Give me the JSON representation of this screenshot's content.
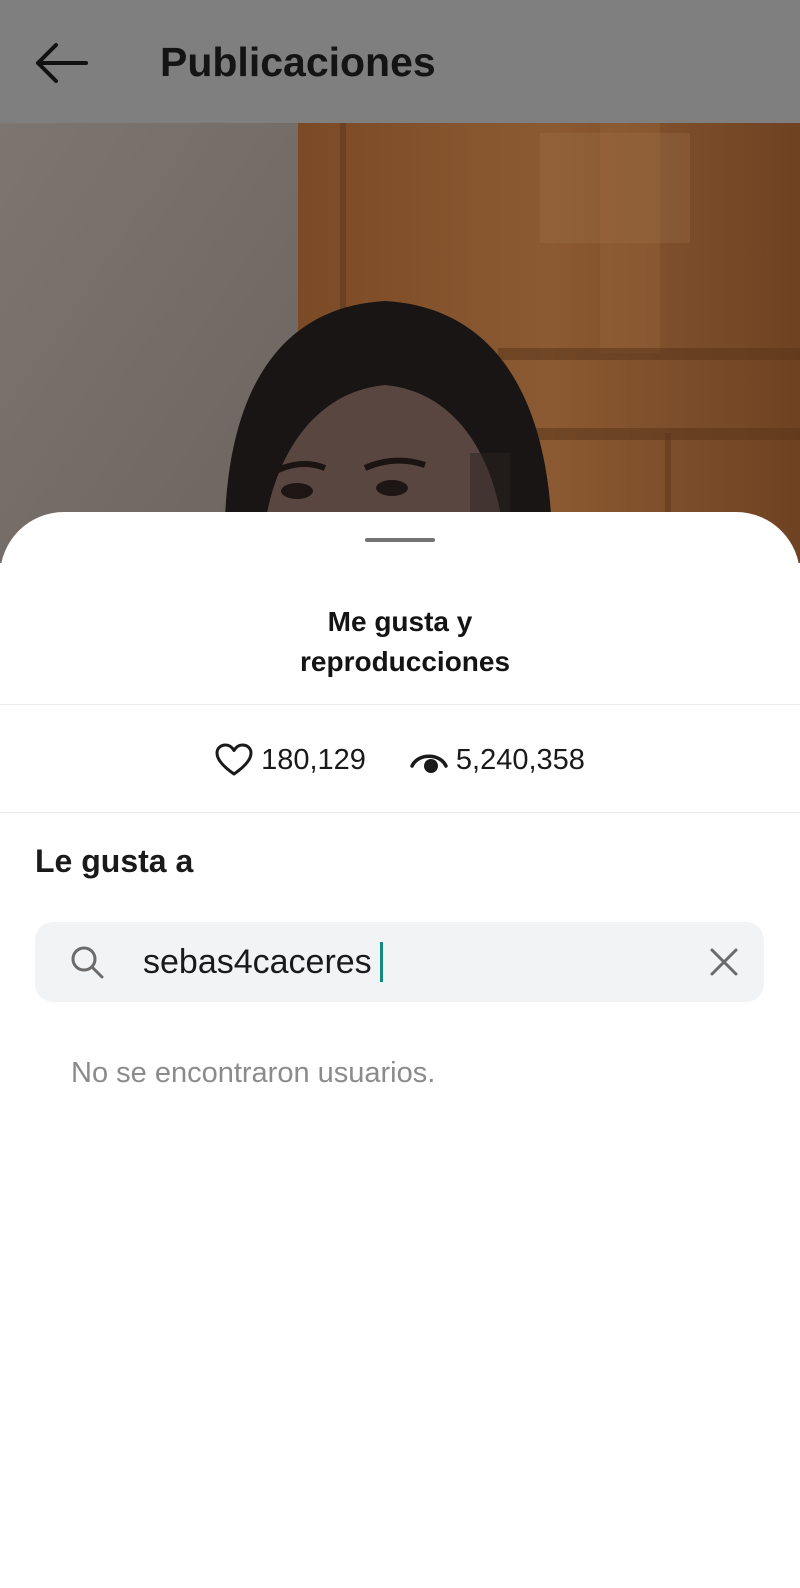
{
  "header": {
    "title": "Publicaciones",
    "back_icon": "arrow-left-icon"
  },
  "sheet": {
    "title": "Me gusta y reproducciones",
    "likes": "180,129",
    "views": "5,240,358",
    "likes_icon": "heart-icon",
    "views_icon": "eye-icon",
    "section_title": "Le gusta a",
    "search": {
      "value": "sebas4caceres",
      "icon": "search-icon",
      "clear_icon": "close-icon"
    },
    "empty_message": "No se encontraron usuarios."
  },
  "colors": {
    "header_bg": "#7f7f7f",
    "caret": "#128a7d",
    "search_bg": "#f2f3f5",
    "muted_text": "#8b8b8b"
  }
}
